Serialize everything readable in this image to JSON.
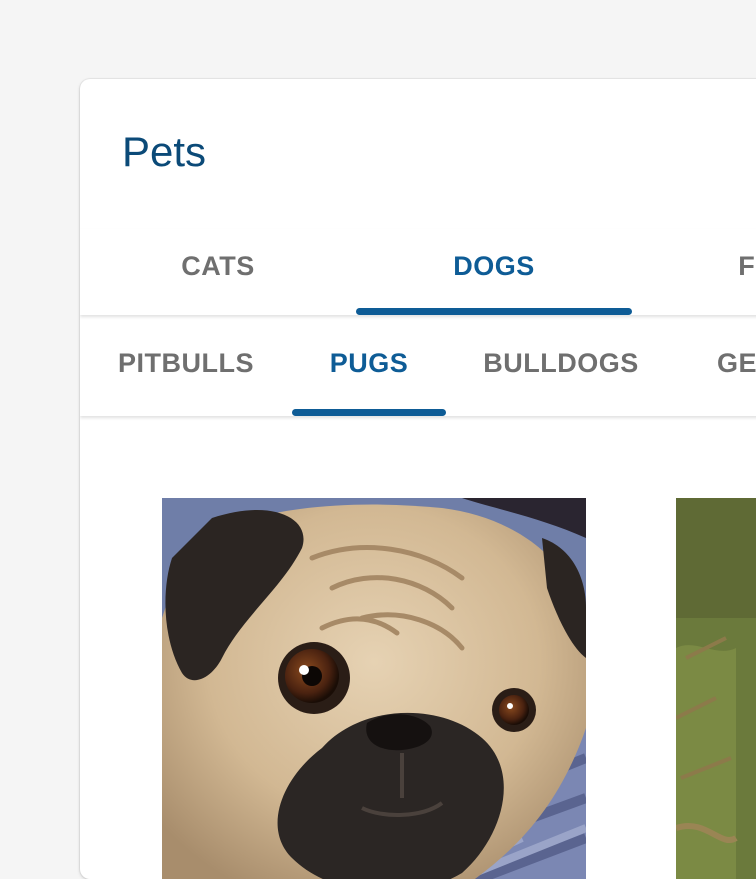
{
  "card": {
    "title": "Pets"
  },
  "tabs": [
    {
      "label": "CATS",
      "active": false
    },
    {
      "label": "DOGS",
      "active": true
    },
    {
      "label": "FISH",
      "active": false
    }
  ],
  "subtabs": [
    {
      "label": "PITBULLS",
      "active": false
    },
    {
      "label": "PUGS",
      "active": true
    },
    {
      "label": "BULLDOGS",
      "active": false
    },
    {
      "label": "GERMAN SHEPHERDS",
      "active": false
    }
  ],
  "gallery": [
    {
      "subject": "pug"
    },
    {
      "subject": "dog"
    }
  ],
  "colors": {
    "accent": "#0e5c96",
    "title": "#0b4a78",
    "inactive_tab": "#6f6f6f",
    "background": "#f5f5f5"
  }
}
